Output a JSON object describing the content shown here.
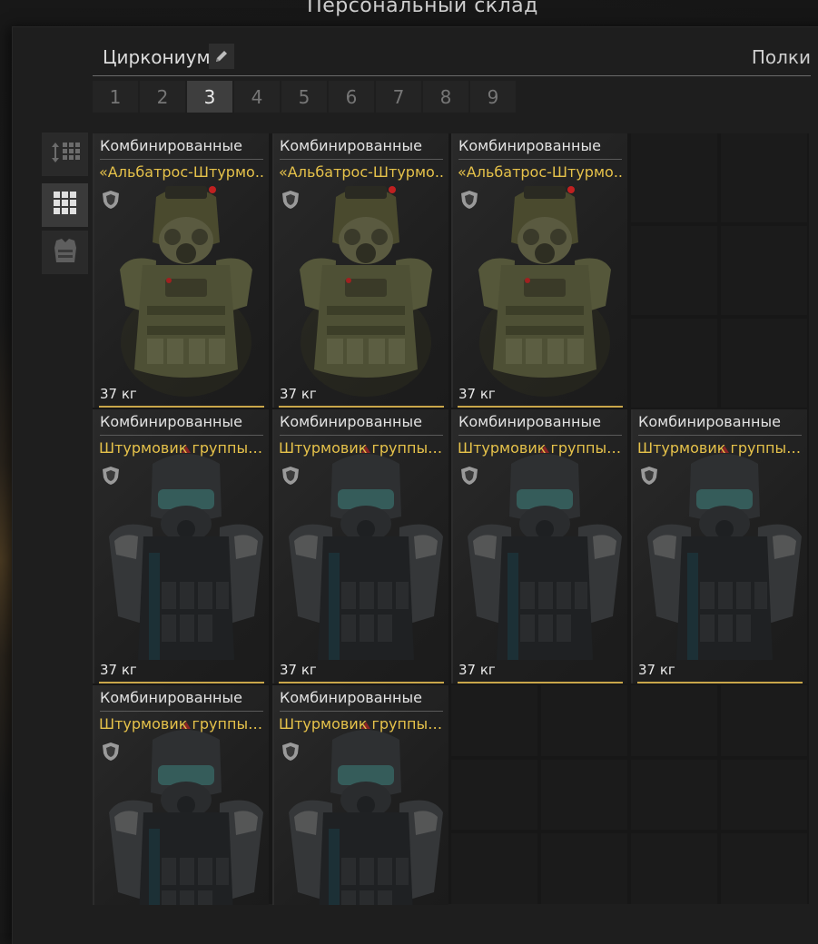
{
  "window_title": "Персональный склад",
  "header": {
    "storage_name": "Циркониум",
    "shelves_label": "Полки"
  },
  "tabs": [
    "1",
    "2",
    "3",
    "4",
    "5",
    "6",
    "7",
    "8",
    "9"
  ],
  "active_tab": "3",
  "items": [
    {
      "category": "Комбинированные",
      "name": "«Альбатрос-Штурмо..",
      "weight": "37 кг",
      "art": "albatross"
    },
    {
      "category": "Комбинированные",
      "name": "«Альбатрос-Штурмо..",
      "weight": "37 кг",
      "art": "albatross"
    },
    {
      "category": "Комбинированные",
      "name": "«Альбатрос-Штурмо..",
      "weight": "37 кг",
      "art": "albatross"
    },
    {
      "category": "Комбинированные",
      "name": "Штурмовик группы «..",
      "weight": "37 кг",
      "art": "stormtrooper"
    },
    {
      "category": "Комбинированные",
      "name": "Штурмовик группы «..",
      "weight": "37 кг",
      "art": "stormtrooper"
    },
    {
      "category": "Комбинированные",
      "name": "Штурмовик группы «..",
      "weight": "37 кг",
      "art": "stormtrooper"
    },
    {
      "category": "Комбинированные",
      "name": "Штурмовик группы «..",
      "weight": "37 кг",
      "art": "stormtrooper"
    },
    {
      "category": "Комбинированные",
      "name": "Штурмовик группы «..",
      "weight": "",
      "art": "stormtrooper"
    },
    {
      "category": "Комбинированные",
      "name": "Штурмовик группы «..",
      "weight": "",
      "art": "stormtrooper"
    }
  ],
  "icons": {
    "edit": "pencil-icon",
    "sort": "sort-vertical-icon",
    "grid_view": "grid-view-icon",
    "armor_filter": "armor-vest-icon",
    "item_protection": "shield-icon"
  },
  "colors": {
    "accent_gold": "#e6c24a",
    "active_tab_bg": "#3e3e3e",
    "panel_bg": "#1e1e1e"
  }
}
